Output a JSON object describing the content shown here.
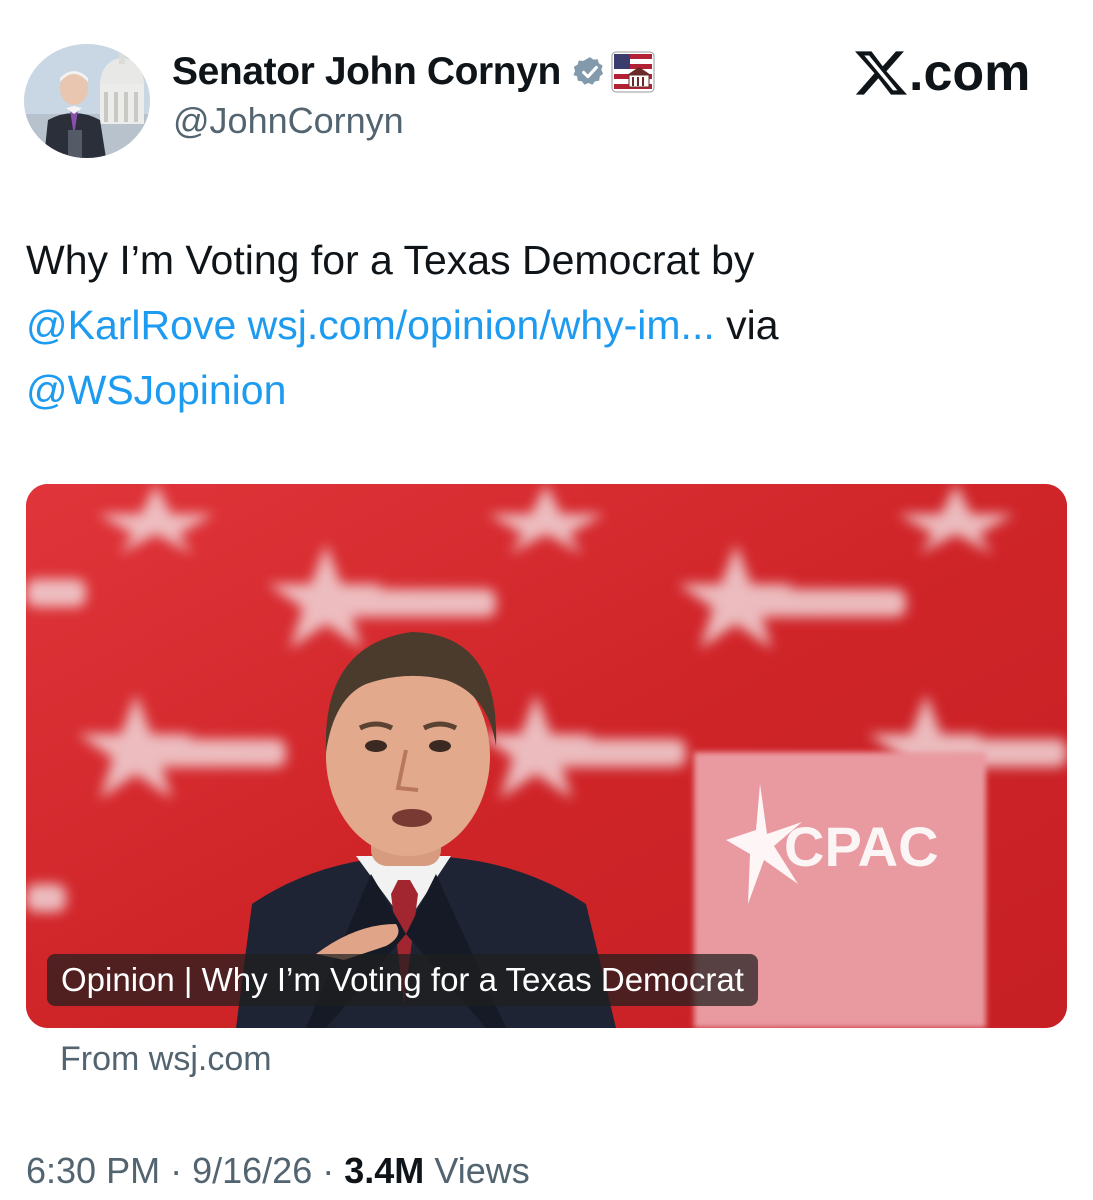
{
  "author": {
    "display_name": "Senator John Cornyn",
    "handle": "@JohnCornyn",
    "avatar_icon": "avatar-photo",
    "verified_icon": "verified-badge-icon",
    "affiliation_icon": "us-senate-flag-icon"
  },
  "site_logo": {
    "mark": "𝕏",
    "suffix": ".com"
  },
  "tweet": {
    "text_start": "Why I’m Voting for a Texas Democrat by",
    "mention_1": "@KarlRove",
    "url": "wsj.com/opinion/why-im...",
    "via": "via",
    "mention_2": "@WSJopinion"
  },
  "card": {
    "caption": "Opinion | Why I’m Voting for a Texas Democrat",
    "source": "From wsj.com",
    "podium_logo": "CPAC"
  },
  "meta": {
    "time": "6:30 PM",
    "separator": "·",
    "date": "9/16/26",
    "views_count": "3.4M",
    "views_label": "Views"
  },
  "colors": {
    "link": "#1d9bf0",
    "secondary_text": "#536471",
    "primary_text": "#0f1419",
    "verified": "#829aab",
    "backdrop_red": "#d42a2e"
  }
}
